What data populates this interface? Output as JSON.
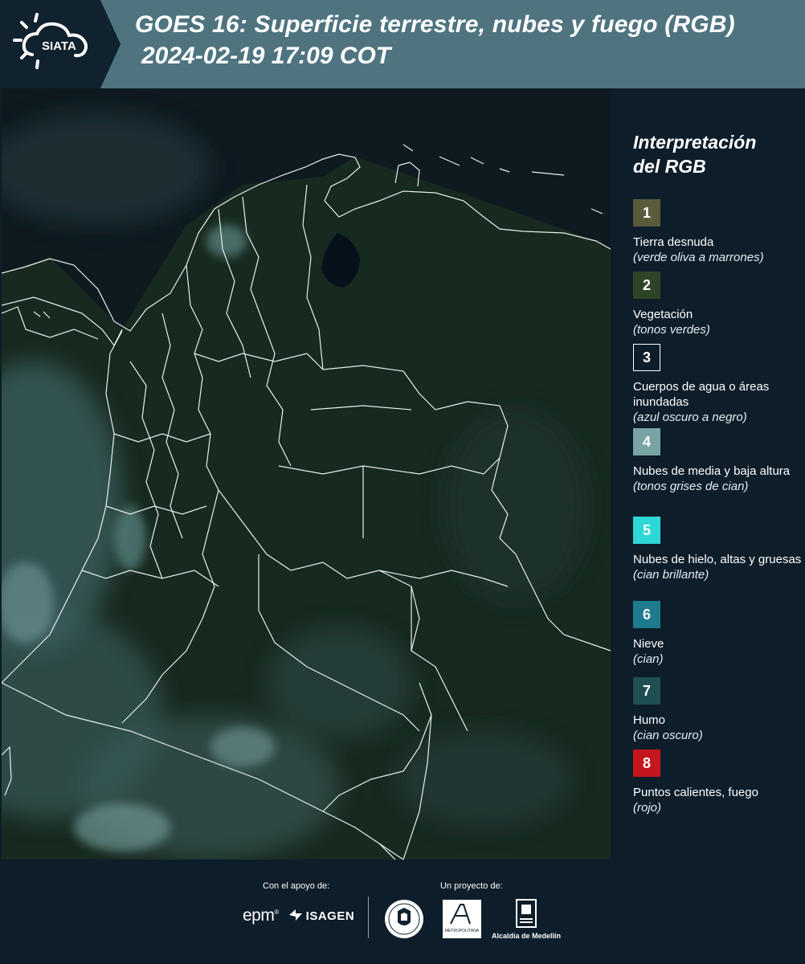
{
  "header": {
    "logo_text": "SIATA",
    "title": "GOES 16: Superficie terrestre, nubes y fuego (RGB)",
    "timestamp": "2024-02-19 17:09 COT"
  },
  "legend": {
    "title_line1": "Interpretación",
    "title_line2": "del RGB",
    "items": [
      {
        "number": "1",
        "label": "Tierra desnuda",
        "note": "(verde oliva a marrones)",
        "color": "#5a5a3d"
      },
      {
        "number": "2",
        "label": "Vegetación",
        "note": "(tonos verdes)",
        "color": "#2e4426"
      },
      {
        "number": "3",
        "label": "Cuerpos de agua o áreas inundadas",
        "note": "(azul oscuro a negro)",
        "color": "#0d1d29"
      },
      {
        "number": "4",
        "label": "Nubes de media y baja altura",
        "note": "(tonos grises de cian)",
        "color": "#7aa3a3"
      },
      {
        "number": "5",
        "label": "Nubes de hielo, altas y gruesas",
        "note": "(cian brillante)",
        "color": "#2ed6d6"
      },
      {
        "number": "6",
        "label": "Nieve",
        "note": "(cian)",
        "color": "#1e7a8f"
      },
      {
        "number": "7",
        "label": "Humo",
        "note": "(cian oscuro)",
        "color": "#1e4f52"
      },
      {
        "number": "8",
        "label": "Puntos calientes, fuego",
        "note": "(rojo)",
        "color": "#c4161c"
      }
    ]
  },
  "footer": {
    "support_label": "Con el apoyo de:",
    "project_label": "Un proyecto de:",
    "sponsor1": "epm",
    "sponsor2": "ISAGEN",
    "partner1": "METROPOLITANA",
    "partner2": "Alcaldía de Medellín"
  }
}
